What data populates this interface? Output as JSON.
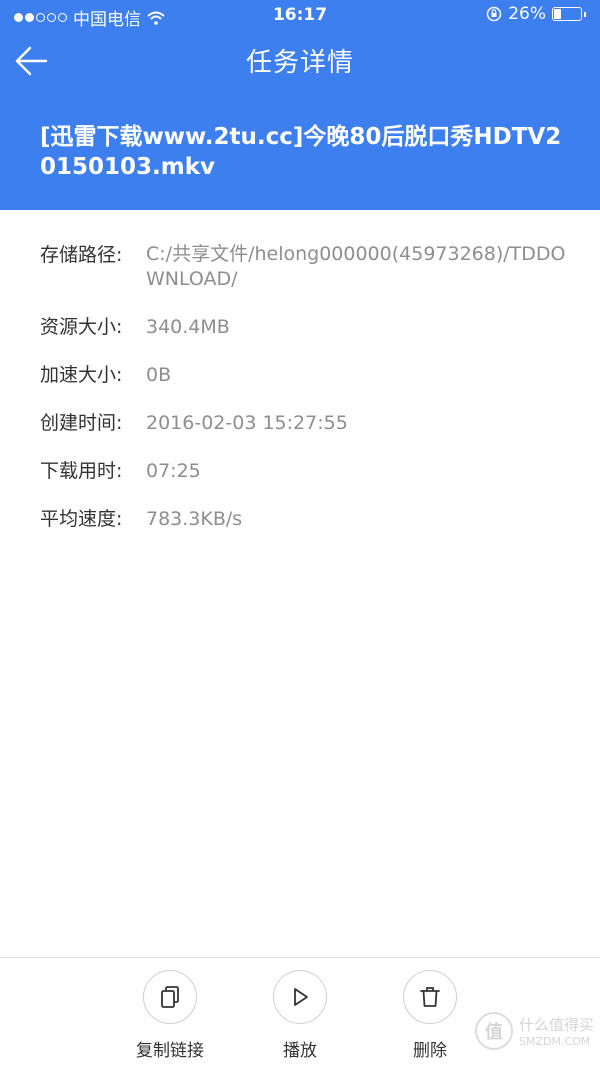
{
  "status_bar": {
    "carrier": "中国电信",
    "time": "16:17",
    "battery_percent": "26%"
  },
  "navbar": {
    "title": "任务详情"
  },
  "file": {
    "name": "[迅雷下载www.2tu.cc]今晚80后脱口秀HDTV20150103.mkv"
  },
  "details": [
    {
      "label": "存储路径:",
      "value": "C:/共享文件/helong000000(45973268)/TDDOWNLOAD/"
    },
    {
      "label": "资源大小:",
      "value": "340.4MB"
    },
    {
      "label": "加速大小:",
      "value": "0B"
    },
    {
      "label": "创建时间:",
      "value": "2016-02-03 15:27:55"
    },
    {
      "label": "下载用时:",
      "value": "07:25"
    },
    {
      "label": "平均速度:",
      "value": "783.3KB/s"
    }
  ],
  "toolbar": {
    "copy_label": "复制链接",
    "play_label": "播放",
    "delete_label": "删除"
  },
  "watermark": {
    "text": "什么值得买",
    "site": "SMZDM.COM"
  },
  "colors": {
    "header_bg": "#3e7ff0",
    "label": "#333333",
    "value": "#8e8e8e"
  }
}
